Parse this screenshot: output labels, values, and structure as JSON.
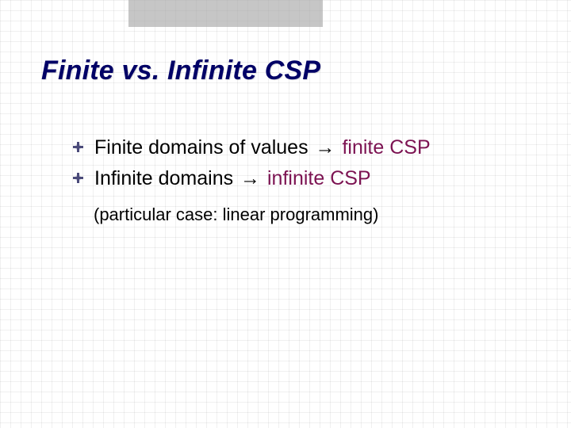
{
  "title": "Finite vs. Infinite CSP",
  "bullets": [
    {
      "prefix": "Finite domains of values ",
      "arrow": "→",
      "suffix": " finite CSP"
    },
    {
      "prefix": "Infinite domains ",
      "arrow": "→",
      "suffix": " infinite CSP"
    }
  ],
  "subnote": "(particular case: linear programming)"
}
